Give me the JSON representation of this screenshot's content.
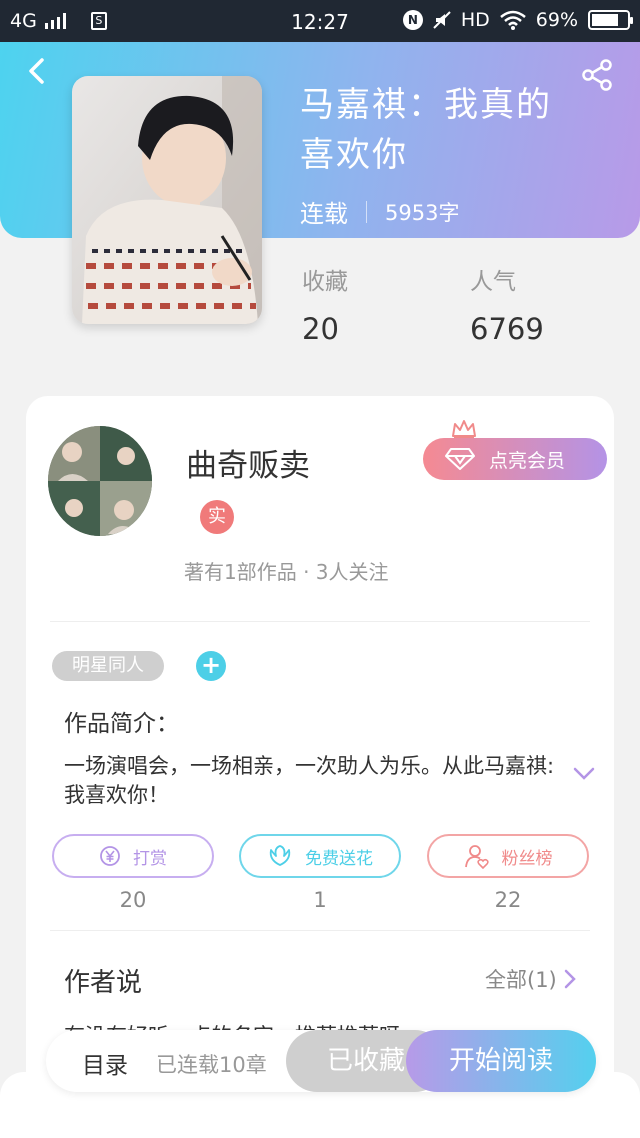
{
  "status_bar": {
    "network": "4G",
    "time": "12:27",
    "hd": "HD",
    "battery": "69%"
  },
  "book": {
    "title": "马嘉祺：我真的喜欢你",
    "status": "连载",
    "word_count": "5953字"
  },
  "stats": [
    {
      "label": "收藏",
      "value": "20"
    },
    {
      "label": "人气",
      "value": "6769"
    }
  ],
  "author": {
    "name": "曲奇贩卖",
    "badge": "实",
    "summary": "著有1部作品 · 3人关注",
    "vip_button": "点亮会员"
  },
  "tag": "明星同人",
  "intro": {
    "title": "作品简介：",
    "text": "一场演唱会，一场相亲，一次助人为乐。从此马嘉祺:我喜欢你！"
  },
  "actions": [
    {
      "label": "打赏",
      "count": "20",
      "color": "#b394e6"
    },
    {
      "label": "免费送花",
      "count": "1",
      "color": "#4dcfe7"
    },
    {
      "label": "粉丝榜",
      "count": "22",
      "color": "#f08a8a"
    }
  ],
  "author_says": {
    "title": "作者说",
    "all_link": "全部(1)",
    "preview": "有没有好听一点的名字，推荐推荐呀"
  },
  "bottom_bar": {
    "toc": "目录",
    "chapters": "已连载10章",
    "collected": "已收藏",
    "start_reading": "开始阅读"
  }
}
